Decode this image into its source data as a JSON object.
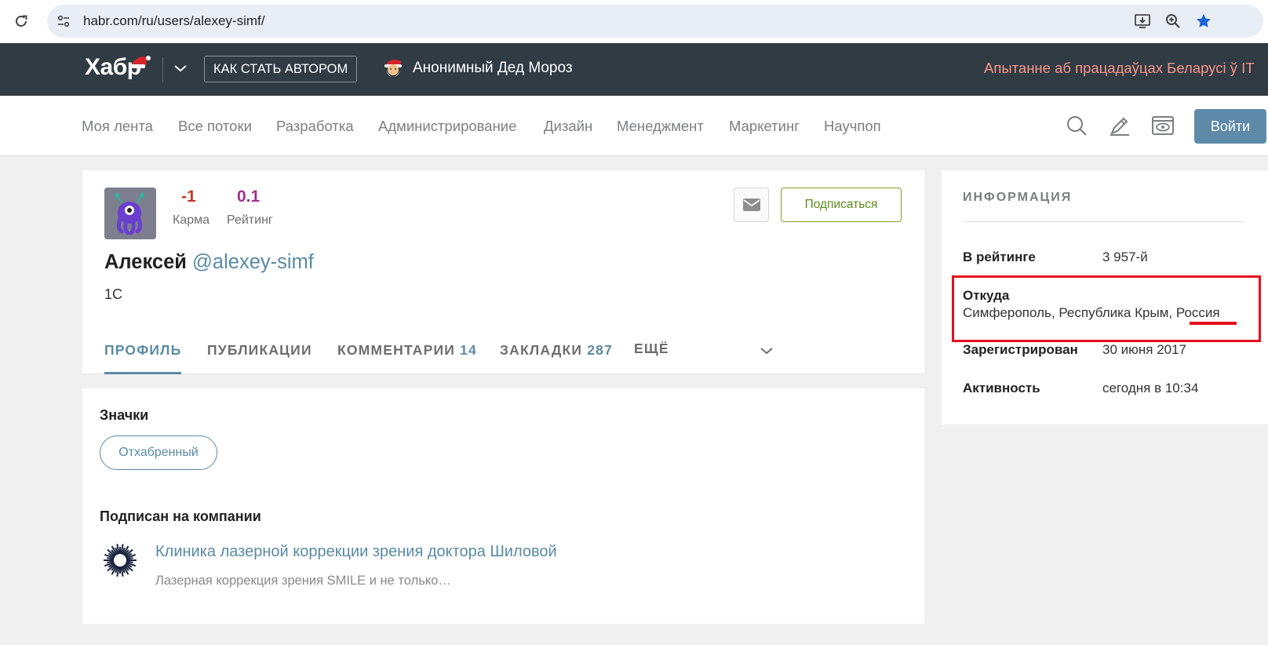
{
  "browser": {
    "url": "habr.com/ru/users/alexey-simf/"
  },
  "header": {
    "logo": "Хабр",
    "howto_label": "КАК СТАТЬ АВТОРОМ",
    "santa_label": "Анонимный Дед Мороз",
    "promo": "Апытанне аб працадаўцах Беларусі ў IT"
  },
  "nav": {
    "items": [
      "Моя лента",
      "Все потоки",
      "Разработка",
      "Администрирование",
      "Дизайн",
      "Менеджмент",
      "Маркетинг",
      "Научпоп"
    ],
    "login_label": "Войти"
  },
  "profile": {
    "karma_value": "-1",
    "karma_label": "Карма",
    "rating_value": "0.1",
    "rating_label": "Рейтинг",
    "subscribe_label": "Подписаться",
    "name": "Алексей",
    "handle": "@alexey-simf",
    "specialization": "1С",
    "tabs": {
      "profile": "ПРОФИЛЬ",
      "publications": "ПУБЛИКАЦИИ",
      "comments": "КОММЕНТАРИИ",
      "comments_count": "14",
      "bookmarks": "ЗАКЛАДКИ",
      "bookmarks_count": "287",
      "more": "ЕЩЁ"
    }
  },
  "badges": {
    "title": "Значки",
    "items": [
      "Отхабренный"
    ]
  },
  "companies": {
    "title": "Подписан на компании",
    "items": [
      {
        "name": "Клиника лазерной коррекции зрения доктора Шиловой",
        "description": "Лазерная коррекция зрения SMILE и не только…"
      }
    ]
  },
  "info": {
    "title": "ИНФОРМАЦИЯ",
    "rating_label": "В рейтинге",
    "rating_value": "3 957-й",
    "location_label": "Откуда",
    "location_value": "Симферополь, Республика Крым, Россия",
    "registered_label": "Зарегистрирован",
    "registered_value": "30 июня 2017",
    "activity_label": "Активность",
    "activity_value": "сегодня в 10:34"
  },
  "colors": {
    "header_bg": "#303b44",
    "accent": "#5a8aa5",
    "karma": "#c0392b",
    "rating": "#a0308a",
    "subscribe": "#7fa02e",
    "highlight": "#e3101c"
  }
}
